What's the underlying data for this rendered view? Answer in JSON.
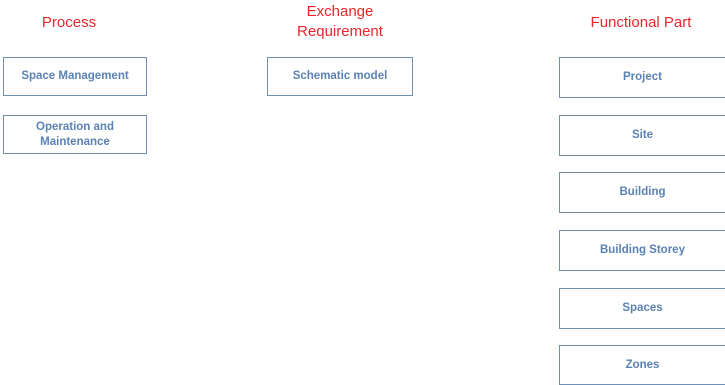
{
  "headings": {
    "process": "Process",
    "exchange": "Exchange\nRequirement",
    "functional": "Functional Part"
  },
  "process": {
    "items": [
      {
        "label": "Space Management"
      },
      {
        "label": "Operation and\nMaintenance"
      }
    ]
  },
  "exchange": {
    "items": [
      {
        "label": "Schematic model"
      }
    ]
  },
  "functional": {
    "items": [
      {
        "label": "Project"
      },
      {
        "label": "Site"
      },
      {
        "label": "Building"
      },
      {
        "label": "Building Storey"
      },
      {
        "label": "Spaces"
      },
      {
        "label": "Zones"
      }
    ]
  },
  "colors": {
    "heading": "#e8262b",
    "box_text": "#5b82b4",
    "box_border": "#6f8fb5"
  }
}
